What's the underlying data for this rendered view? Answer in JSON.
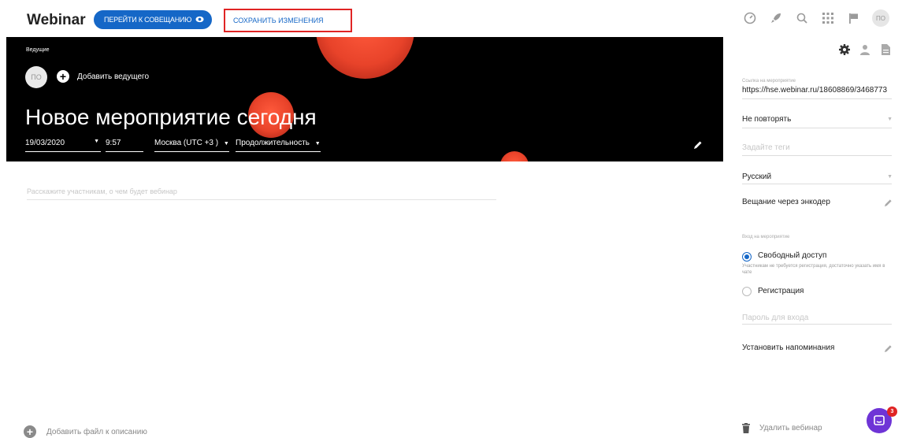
{
  "header": {
    "brand": "Webinar",
    "goto_label": "ПЕРЕЙТИ К СОВЕЩАНИЮ",
    "save_label": "СОХРАНИТЬ ИЗМЕНЕНИЯ",
    "avatar_initials": "ПО"
  },
  "hero": {
    "hosts_label": "Ведущие",
    "host_initials": "ПО",
    "add_host_label": "Добавить ведущего",
    "title": "Новое мероприятие сегодня",
    "date": "19/03/2020",
    "time": "9:57",
    "timezone": "Москва (UTC +3 )",
    "duration": "Продолжительность"
  },
  "main": {
    "description_placeholder": "Расскажите участникам, о чем будет вебинар",
    "add_file_label": "Добавить файл к описанию"
  },
  "sidebar": {
    "link_label": "Ссылка на мероприятие",
    "link_value": "https://hse.webinar.ru/18608869/3468773",
    "repeat_value": "Не повторять",
    "tags_placeholder": "Задайте теги",
    "language_value": "Русский",
    "encoder_label": "Вещание через энкодер",
    "access_label": "Вход на мероприятие",
    "free_access_label": "Свободный доступ",
    "free_access_hint": "Участникам не требуется регистрация, достаточно указать имя в чате",
    "registration_label": "Регистрация",
    "password_placeholder": "Пароль для входа",
    "reminders_label": "Установить напоминания",
    "delete_label": "Удалить вебинар"
  },
  "chat": {
    "badge_count": "3"
  },
  "colors": {
    "accent": "#1567c7",
    "highlight": "#e02424",
    "hero_bg": "#000000",
    "blob": "#e8432a",
    "chat": "#6e34d6"
  }
}
